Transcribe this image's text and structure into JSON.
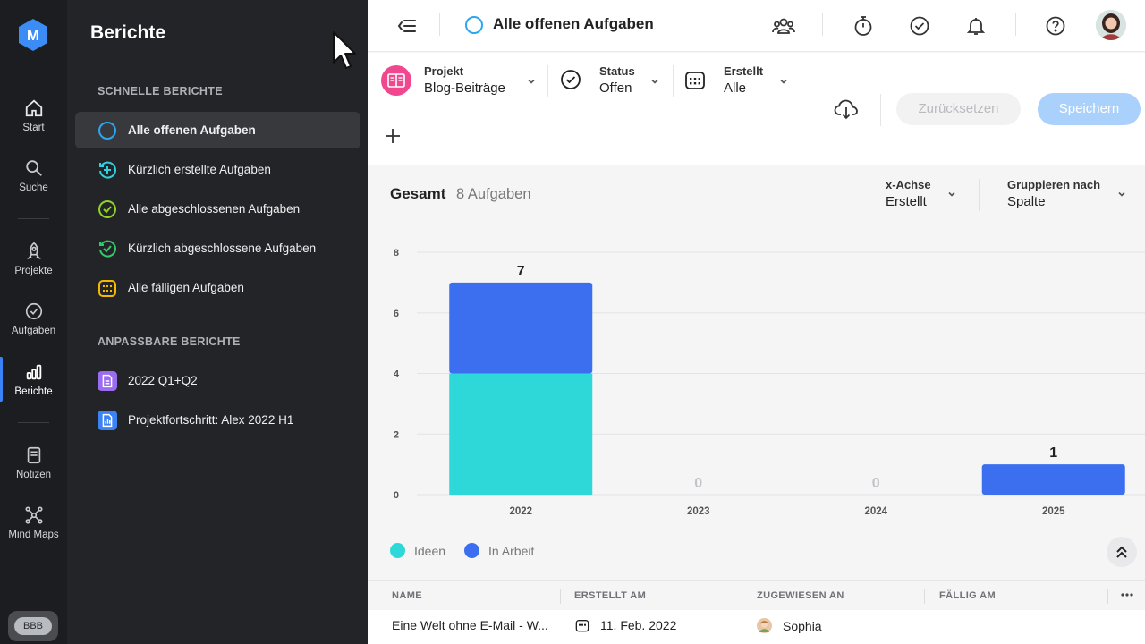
{
  "rail": {
    "avatar_initials": "BBB",
    "items": [
      {
        "label": "Start"
      },
      {
        "label": "Suche"
      },
      {
        "label": "Projekte"
      },
      {
        "label": "Aufgaben"
      },
      {
        "label": "Berichte"
      },
      {
        "label": "Notizen"
      },
      {
        "label": "Mind Maps"
      }
    ]
  },
  "sidebar": {
    "title": "Berichte",
    "quick_section": "SCHNELLE BERICHTE",
    "quick": [
      {
        "label": "Alle offenen Aufgaben"
      },
      {
        "label": "Kürzlich erstellte Aufgaben"
      },
      {
        "label": "Alle abgeschlossenen Aufgaben"
      },
      {
        "label": "Kürzlich abgeschlossene Aufgaben"
      },
      {
        "label": "Alle fälligen Aufgaben"
      }
    ],
    "custom_section": "ANPASSBARE BERICHTE",
    "custom": [
      {
        "label": "2022 Q1+Q2"
      },
      {
        "label": "Projektfortschritt: Alex 2022 H1"
      }
    ]
  },
  "header": {
    "title": "Alle offenen Aufgaben"
  },
  "filters": {
    "project": {
      "label": "Projekt",
      "value": "Blog-Beiträge"
    },
    "status": {
      "label": "Status",
      "value": "Offen"
    },
    "created": {
      "label": "Erstellt",
      "value": "Alle"
    },
    "reset_label": "Zurücksetzen",
    "save_label": "Speichern"
  },
  "summary": {
    "total_label": "Gesamt",
    "count_label": "8 Aufgaben",
    "xaxis": {
      "label": "x-Achse",
      "value": "Erstellt"
    },
    "group": {
      "label": "Gruppieren nach",
      "value": "Spalte"
    }
  },
  "colors": {
    "ideen": "#2ed8d8",
    "in_arbeit": "#3b6ff0"
  },
  "chart_data": {
    "type": "bar",
    "stacked": true,
    "categories": [
      "2022",
      "2023",
      "2024",
      "2025"
    ],
    "series": [
      {
        "name": "Ideen",
        "values": [
          4,
          0,
          0,
          0
        ]
      },
      {
        "name": "In Arbeit",
        "values": [
          3,
          0,
          0,
          1
        ]
      }
    ],
    "totals": [
      7,
      0,
      0,
      1
    ],
    "ylim": [
      0,
      8
    ],
    "yticks": [
      0,
      2,
      4,
      6,
      8
    ],
    "grid": true,
    "legend": "bottom-left"
  },
  "table": {
    "columns": [
      "NAME",
      "ERSTELLT AM",
      "ZUGEWIESEN AN",
      "FÄLLIG AM"
    ],
    "rows": [
      {
        "name": "Eine Welt ohne E-Mail - W...",
        "created": "11. Feb. 2022",
        "assignee": "Sophia",
        "due": ""
      }
    ]
  }
}
